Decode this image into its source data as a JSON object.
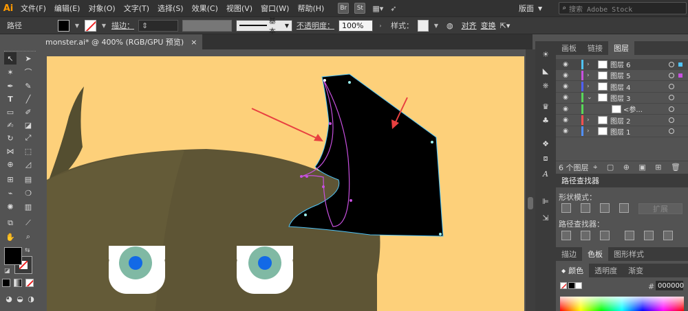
{
  "app": {
    "logo": "Ai"
  },
  "menu": [
    "文件(F)",
    "编辑(E)",
    "对象(O)",
    "文字(T)",
    "选择(S)",
    "效果(C)",
    "视图(V)",
    "窗口(W)",
    "帮助(H)"
  ],
  "menu_icons": {
    "bridge": "Br",
    "stock": "St"
  },
  "workspace": "版面",
  "search": {
    "placeholder": "搜索 Adobe Stock"
  },
  "control": {
    "path_label": "路径",
    "stroke_label": "描边：",
    "stroke_style": "基本",
    "opacity_label": "不透明度：",
    "opacity_value": "100%",
    "style_label": "样式：",
    "align_link": "对齐",
    "transform_link": "变换"
  },
  "document_tab": {
    "title": "monster.ai* @ 400% (RGB/GPU 预览)",
    "close": "×"
  },
  "layers_panel": {
    "tabs": [
      "画板",
      "链接",
      "图层"
    ],
    "active_tab": "图层",
    "layers": [
      {
        "name": "图层 6",
        "color": "#4fc3f7",
        "expanded": false,
        "selected": true
      },
      {
        "name": "图层 5",
        "color": "#c850e0",
        "expanded": false,
        "selected": false
      },
      {
        "name": "图层 4",
        "color": "#5060ff",
        "expanded": false,
        "selected": false
      },
      {
        "name": "图层 3",
        "color": "#58d858",
        "expanded": true,
        "selected": false
      },
      {
        "name": "<参...",
        "color": "#58d858",
        "expanded": false,
        "selected": false,
        "sublayer": true
      },
      {
        "name": "图层 2",
        "color": "#ff5050",
        "expanded": false,
        "selected": false
      },
      {
        "name": "图层 1",
        "color": "#5090ff",
        "expanded": false,
        "selected": false
      }
    ],
    "footer": "6 个图层"
  },
  "pathfinder": {
    "title": "路径查找器",
    "shape_modes": "形状模式：",
    "expand": "扩展",
    "pathfinders": "路径查找器："
  },
  "color_panel": {
    "tabs_top": [
      "描边",
      "色板",
      "图形样式"
    ],
    "active_top": "色板",
    "tabs": [
      "颜色",
      "透明度",
      "渐变"
    ],
    "hex_label": "#",
    "hex_value": "000000"
  },
  "colors": {
    "artboard": "#fdd07a",
    "monster_body": "#5e5535",
    "horn": "#544e30",
    "eye_iris": "#80b9a4",
    "eye_pupil": "#1269e6",
    "arrow": "#e84040",
    "selection": "#4fc3f7",
    "path_handles": "#c850e0"
  }
}
